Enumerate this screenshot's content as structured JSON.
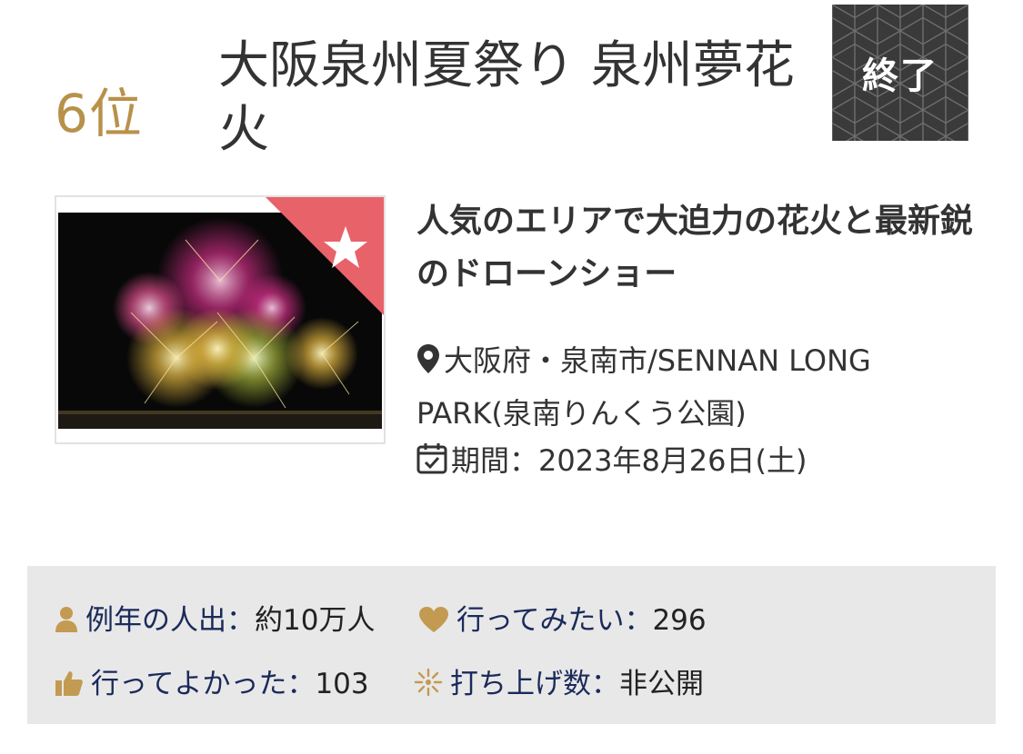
{
  "rank": "6位",
  "event": {
    "title": "大阪泉州夏祭り 泉州夢花火",
    "status": "終了",
    "headline": "人気のエリアで大迫力の花火と最新鋭のドローンショー",
    "location": "大阪府・泉南市/SENNAN LONG PARK(泉南りんくう公園)",
    "date_label": "期間：2023年8月26日(土)"
  },
  "stats": {
    "attendance_label": "例年の人出：",
    "attendance_value": "約10万人",
    "want_to_go_label": "行ってみたい：",
    "want_to_go_value": "296",
    "glad_went_label": "行ってよかった：",
    "glad_went_value": "103",
    "launches_label": "打ち上げ数：",
    "launches_value": "非公開"
  },
  "icons": {
    "location": "map-pin-icon",
    "date": "calendar-check-icon",
    "attendance": "person-icon",
    "want_to_go": "heart-icon",
    "glad_went": "thumbs-up-icon",
    "launches": "firework-icon",
    "ribbon": "star-icon"
  },
  "colors": {
    "rank": "#b8914a",
    "icon_gold": "#c39a52",
    "label_navy": "#1a2a5a",
    "ribbon": "#e8626a",
    "stats_bg": "#e8e8e8",
    "badge_bg": "#3a3a3a"
  }
}
